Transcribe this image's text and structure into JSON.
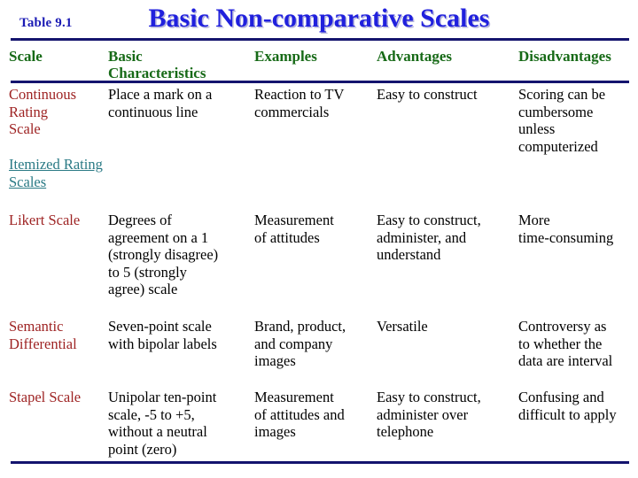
{
  "header": {
    "table_label": "Table 9.1",
    "title": "Basic Non-comparative Scales",
    "label_color": "#1a1ab4",
    "title_color": "#2020dd",
    "rule_color": "#14146e"
  },
  "table": {
    "columns": [
      {
        "label": "Scale",
        "color": "#176a17"
      },
      {
        "label": "Basic\nCharacteristics",
        "color": "#176a17"
      },
      {
        "label": "Examples",
        "color": "#176a17"
      },
      {
        "label": "Advantages",
        "color": "#176a17"
      },
      {
        "label": "Disadvantages",
        "color": "#176a17"
      }
    ],
    "rows": [
      {
        "kind": "data",
        "scale": "Continuous\nRating\nScale",
        "scale_color": "#9e2323",
        "characteristics": "Place a mark on a\ncontinuous line",
        "examples": "Reaction to TV\ncommercials",
        "advantages": "Easy to construct",
        "disadvantages": "Scoring can be\ncumbersome\nunless\ncomputerized"
      },
      {
        "kind": "section",
        "scale": "Itemized Rating\nScales",
        "scale_color": "#2a7a85",
        "characteristics": "",
        "examples": "",
        "advantages": "",
        "disadvantages": ""
      },
      {
        "kind": "data",
        "scale": "Likert Scale",
        "scale_color": "#9e2323",
        "characteristics": "Degrees of\nagreement on a 1\n(strongly disagree)\nto 5 (strongly\nagree) scale",
        "examples": "Measurement\nof attitudes",
        "advantages": "Easy to construct,\nadminister, and\nunderstand",
        "disadvantages": "More\ntime-consuming"
      },
      {
        "kind": "data",
        "scale": "Semantic\nDifferential",
        "scale_color": "#9e2323",
        "characteristics": "Seven-point scale\nwith bipolar labels",
        "examples": "Brand, product,\nand company\nimages",
        "advantages": "Versatile",
        "disadvantages": "Controversy as\nto whether the\ndata are interval"
      },
      {
        "kind": "data",
        "scale": "Stapel Scale",
        "scale_color": "#9e2323",
        "characteristics": "Unipolar ten-point\nscale, -5 to +5,\nwithout a neutral\npoint (zero)",
        "examples": "Measurement\nof attitudes and\nimages",
        "advantages": "Easy to construct,\nadminister over\ntelephone",
        "disadvantages": "Confusing and\ndifficult to apply"
      }
    ]
  }
}
